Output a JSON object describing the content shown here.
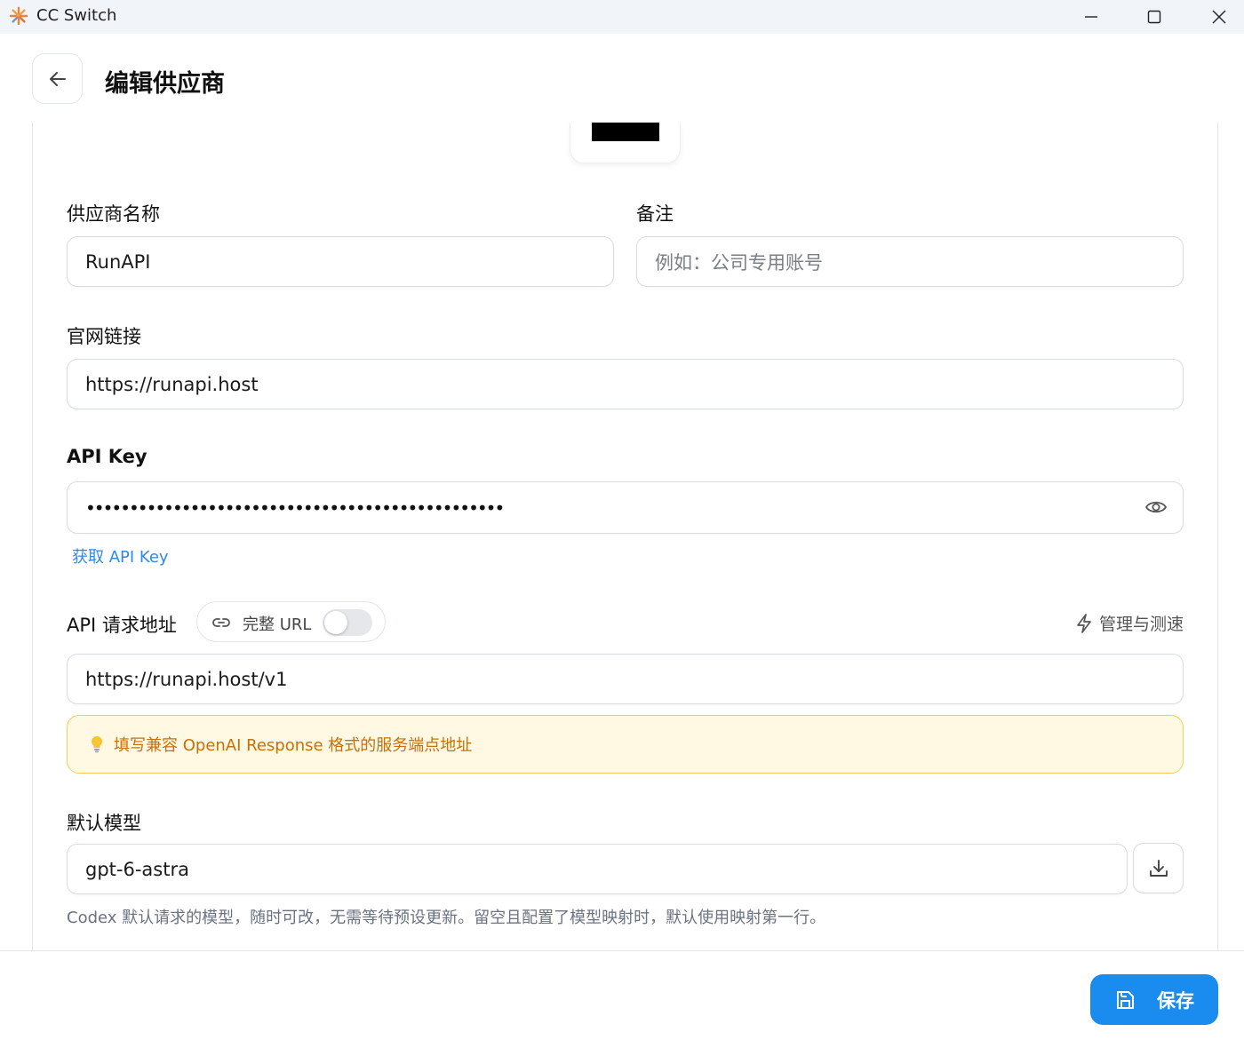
{
  "window": {
    "title": "CC Switch",
    "controls": [
      "minimize-icon",
      "maximize-icon",
      "close-icon"
    ]
  },
  "header": {
    "back_icon": "arrow-left-icon",
    "title": "编辑供应商"
  },
  "form": {
    "provider_name": {
      "label": "供应商名称",
      "value": "RunAPI"
    },
    "notes": {
      "label": "备注",
      "placeholder": "例如：公司专用账号",
      "value": ""
    },
    "website": {
      "label": "官网链接",
      "value": "https://runapi.host"
    },
    "api_key": {
      "label": "API Key",
      "masked_value": "••••••••••••••••••••••••••••••••••••••••••••••••",
      "toggle_icon": "eye-icon",
      "get_key_link": "获取 API Key"
    },
    "endpoint": {
      "label": "API 请求地址",
      "full_url_toggle": {
        "icon": "link-icon",
        "label": "完整 URL",
        "enabled": false
      },
      "manage_link": {
        "icon": "lightning-icon",
        "label": "管理与测速"
      },
      "value": "https://runapi.host/v1",
      "hint": {
        "icon": "lightbulb-icon",
        "text": "填写兼容 OpenAI Response 格式的服务端点地址"
      }
    },
    "default_model": {
      "label": "默认模型",
      "value": "gpt-6-astra",
      "fetch_icon": "download-icon",
      "helper": "Codex 默认请求的模型，随时可改，无需等待预设更新。留空且配置了模型映射时，默认使用映射第一行。"
    }
  },
  "footer": {
    "save_icon": "save-icon",
    "save_label": "保存"
  },
  "colors": {
    "accent": "#1a8cf0",
    "link": "#2f8ae6",
    "hint_bg": "#fff8e3",
    "hint_border": "#f2cf5b",
    "hint_text": "#c7700a",
    "titlebar_bg": "#f1f4f8"
  }
}
